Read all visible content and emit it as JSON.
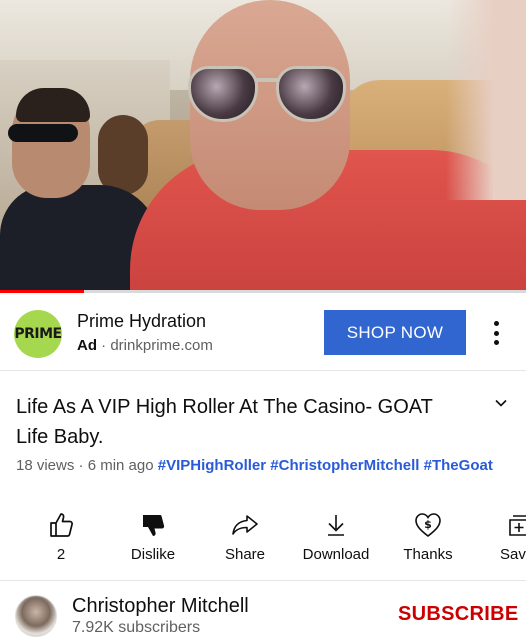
{
  "player": {
    "progress_fraction": 0.16
  },
  "ad": {
    "logo_text": "PRIME",
    "title": "Prime Hydration",
    "label": "Ad",
    "separator": "·",
    "domain": "drinkprime.com",
    "cta": "SHOP NOW",
    "cta_color": "#3166d1"
  },
  "video": {
    "title": "Life As A VIP High Roller At The Casino- GOAT Life Baby.",
    "views": "18 views",
    "age": "6 min ago",
    "hashtags": [
      "#VIPHighRoller",
      "#ChristopherMitchell",
      "#TheGoat"
    ]
  },
  "actions": [
    {
      "icon": "thumbs-up-icon",
      "label": "2"
    },
    {
      "icon": "thumbs-down-icon",
      "label": "Dislike"
    },
    {
      "icon": "share-icon",
      "label": "Share"
    },
    {
      "icon": "download-icon",
      "label": "Download"
    },
    {
      "icon": "thanks-icon",
      "label": "Thanks"
    },
    {
      "icon": "save-icon",
      "label": "Sav"
    }
  ],
  "channel": {
    "name": "Christopher Mitchell",
    "subscribers": "7.92K subscribers",
    "subscribe_label": "SUBSCRIBE",
    "subscribe_color": "#cc0000"
  }
}
